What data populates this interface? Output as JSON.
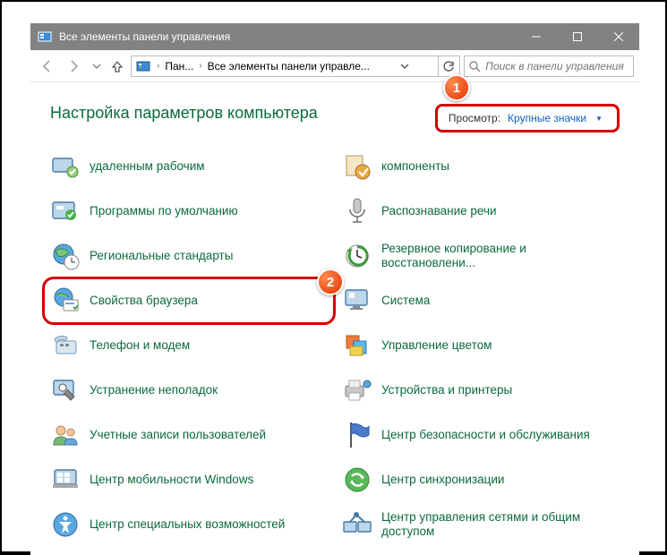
{
  "window": {
    "title": "Все элементы панели управления"
  },
  "breadcrumb": {
    "seg1": "Пан...",
    "seg2": "Все элементы панели управле..."
  },
  "search": {
    "placeholder": "Поиск в панели управления"
  },
  "header": {
    "title": "Настройка параметров компьютера"
  },
  "view": {
    "label": "Просмотр:",
    "value": "Крупные значки"
  },
  "callouts": {
    "one": "1",
    "two": "2"
  },
  "items": {
    "left": [
      "удаленным рабочим",
      "Программы по умолчанию",
      "Региональные стандарты",
      "Свойства браузера",
      "Телефон и модем",
      "Устранение неполадок",
      "Учетные записи пользователей",
      "Центр мобильности Windows",
      "Центр специальных возможностей"
    ],
    "right": [
      "компоненты",
      "Распознавание речи",
      "Резервное копирование и восстановлени...",
      "Система",
      "Управление цветом",
      "Устройства и принтеры",
      "Центр безопасности и обслуживания",
      "Центр синхронизации",
      "Центр управления сетями и общим доступом"
    ]
  }
}
